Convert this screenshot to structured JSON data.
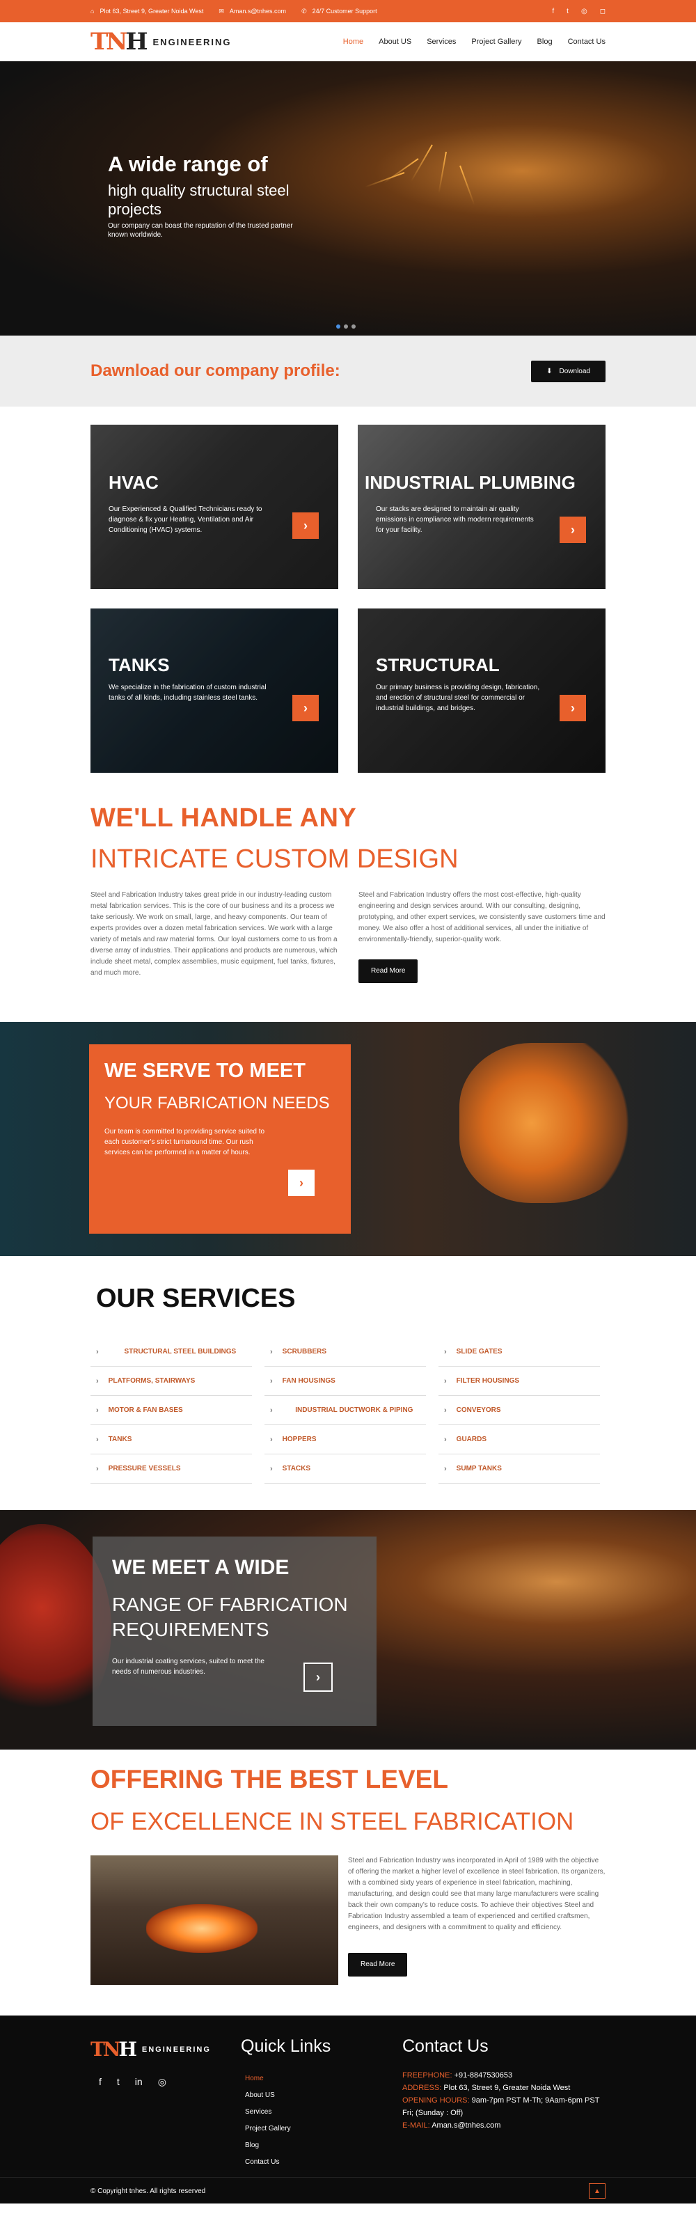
{
  "topbar": {
    "address": "Plot 63, Street 9, Greater Noida West",
    "email": "Aman.s@tnhes.com",
    "support": "24/7 Customer Support",
    "social": [
      "f",
      "t",
      "gh",
      "ig"
    ]
  },
  "brand": {
    "mark_a": "TN",
    "mark_b": "H",
    "word": "ENGINEERING"
  },
  "nav": [
    "Home",
    "About US",
    "Services",
    "Project Gallery",
    "Blog",
    "Contact Us"
  ],
  "hero": {
    "h1": "A wide range of",
    "h2": "high quality structural steel projects",
    "p": "Our company can boast the reputation of the trusted partner known worldwide."
  },
  "download": {
    "title": "Dawnload our company profile:",
    "button": "Download"
  },
  "cards": [
    {
      "title": "HVAC",
      "text": "Our Experienced & Qualified Technicians ready to diagnose & fix your Heating, Ventilation and Air Conditioning (HVAC) systems."
    },
    {
      "title": "INDUSTRIAL PLUMBING",
      "text": "Our stacks are designed to maintain air quality emissions in compliance with modern requirements for your facility."
    },
    {
      "title": "TANKS",
      "text": "We specialize in the fabrication of custom industrial tanks of all kinds, including stainless steel tanks."
    },
    {
      "title": "STRUCTURAL",
      "text": "Our primary business is providing design, fabrication, and erection of structural steel for commercial or industrial buildings, and bridges."
    }
  ],
  "intro": {
    "t1": "WE'LL HANDLE ANY",
    "t2": "INTRICATE CUSTOM DESIGN",
    "left": "Steel and Fabrication Industry takes great pride in our industry-leading custom metal fabrication services. This is the core of our business and its a process we take seriously. We work on small, large, and heavy components. Our team of experts provides over a dozen metal fabrication services. We work with a large variety of metals and raw material forms. Our loyal customers come to us from a diverse array of industries. Their applications and products are numerous, which include sheet metal, complex assemblies, music equipment, fuel tanks, fixtures, and much more.",
    "right": "Steel and Fabrication Industry offers the most cost-effective, high-quality engineering and design services around. With our consulting, designing, prototyping, and other expert services, we consistently save customers time and money. We also offer a host of additional services, all under the initiative of environmentally-friendly, superior-quality work.",
    "button": "Read More"
  },
  "serve": {
    "h3": "WE SERVE TO MEET",
    "h4": "YOUR FABRICATION NEEDS",
    "p": "Our team is committed to providing service suited to each customer's strict turnaround time. Our rush services can be performed in a matter of hours."
  },
  "services": {
    "bold": "OUR",
    "rest": " SERVICES",
    "col1": [
      "STRUCTURAL STEEL BUILDINGS",
      "PLATFORMS, STAIRWAYS",
      "MOTOR & FAN BASES",
      "TANKS",
      "PRESSURE VESSELS"
    ],
    "col2": [
      "SCRUBBERS",
      "FAN HOUSINGS",
      "INDUSTRIAL DUCTWORK & PIPING",
      "HOPPERS",
      "STACKS"
    ],
    "col3": [
      "SLIDE GATES",
      "FILTER HOUSINGS",
      "CONVEYORS",
      "GUARDS",
      "SUMP TANKS"
    ]
  },
  "wide": {
    "h3": "WE MEET A WIDE",
    "h4": "RANGE OF FABRICATION REQUIREMENTS",
    "p": "Our industrial coating services, suited to meet the needs of numerous industries."
  },
  "excel": {
    "t1": "OFFERING THE BEST LEVEL",
    "t2": "OF EXCELLENCE IN STEEL FABRICATION",
    "text": "Steel and Fabrication Industry was incorporated in April of 1989 with the objective of offering the market a higher level of excellence in steel fabrication. Its organizers, with a combined sixty years of experience in steel fabrication, machining, manufacturing, and design could see that many large manufacturers were scaling back their own company's to reduce costs. To achieve their objectives Steel and Fabrication Industry assembled a team of experienced and certified craftsmen, engineers, and designers with a commitment to quality and efficiency.",
    "button": "Read More"
  },
  "footer": {
    "quick_title": "Quick Links",
    "links": [
      "Home",
      "About US",
      "Services",
      "Project Gallery",
      "Blog",
      "Contact Us"
    ],
    "contact_title": "Contact Us",
    "freephone_k": "FREEPHONE:",
    "freephone_v": "+91-8847530653",
    "address_k": "ADDRESS:",
    "address_v": "Plot 63, Street 9, Greater Noida West",
    "hours_k": "OPENING HOURS:",
    "hours_v": "9am-7pm PST M-Th; 9Aam-6pm PST Fri; (Sunday : Off)",
    "email_k": "E-MAIL:",
    "email_v": "Aman.s@tnhes.com",
    "copyright": "© Copyright tnhes. All rights reserved"
  },
  "colors": {
    "accent": "#e8602c",
    "dark": "#0c0c0c"
  }
}
